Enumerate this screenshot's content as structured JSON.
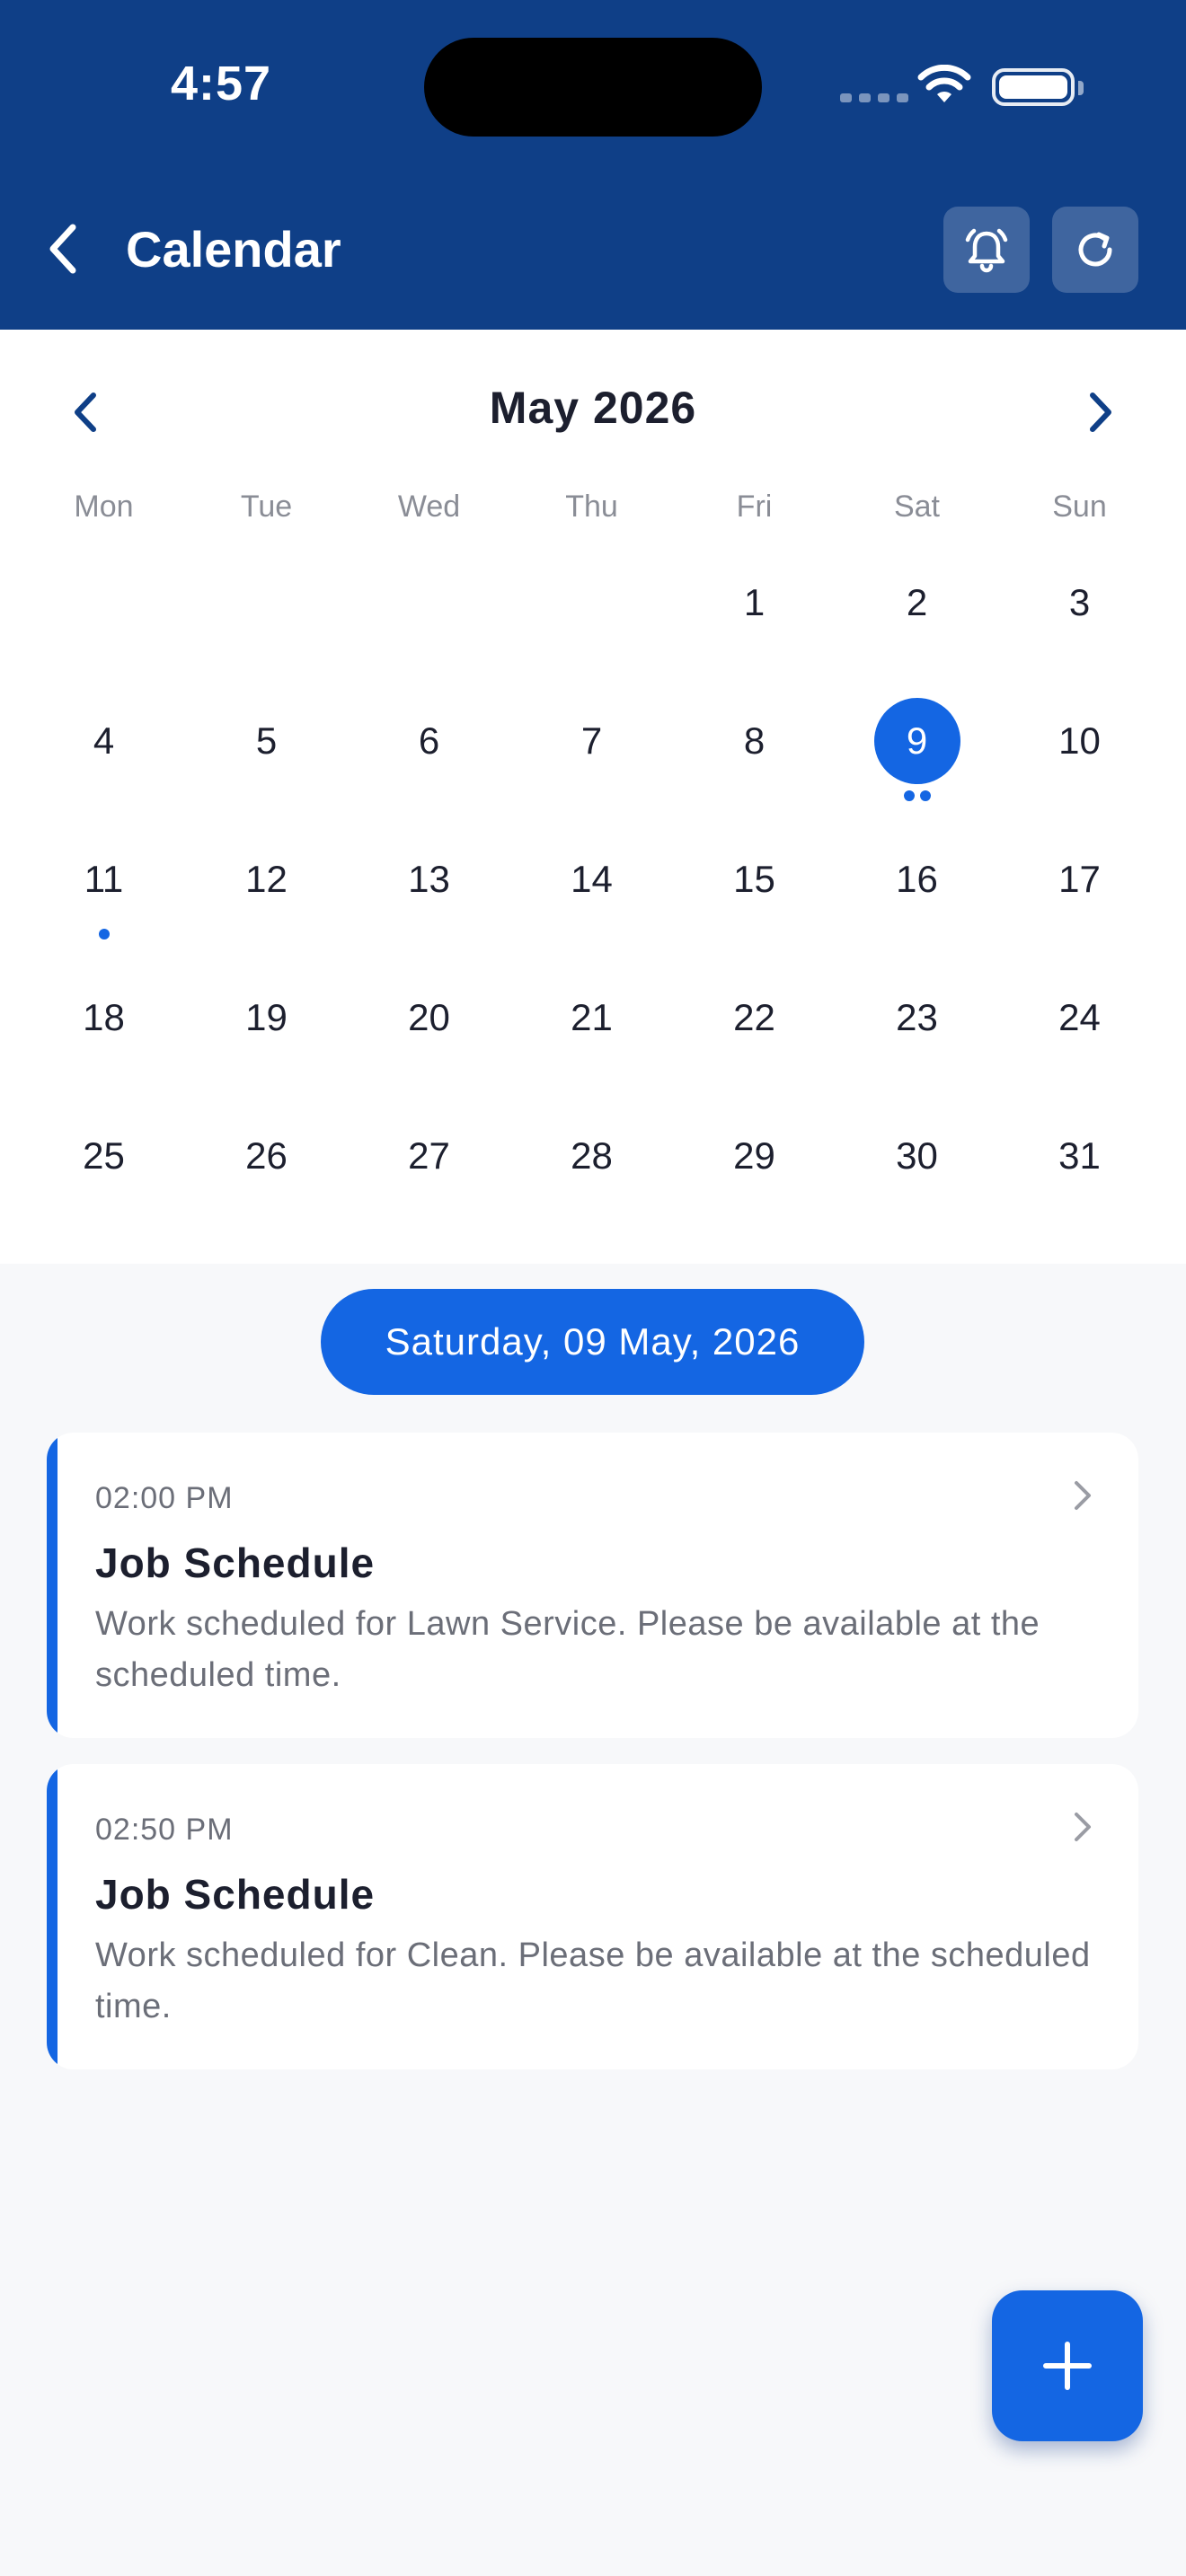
{
  "status_bar": {
    "time": "4:57"
  },
  "header": {
    "title": "Calendar",
    "back_icon": "chevron-left-icon",
    "actions": [
      {
        "name": "alarm-bell-icon"
      },
      {
        "name": "refresh-icon"
      }
    ],
    "background_color": "#0f3f87"
  },
  "calendar": {
    "month_label": "May 2026",
    "weekdays": [
      "Mon",
      "Tue",
      "Wed",
      "Thu",
      "Fri",
      "Sat",
      "Sun"
    ],
    "leading_empty_days": 4,
    "days": [
      "1",
      "2",
      "3",
      "4",
      "5",
      "6",
      "7",
      "8",
      "9",
      "10",
      "11",
      "12",
      "13",
      "14",
      "15",
      "16",
      "17",
      "18",
      "19",
      "20",
      "21",
      "22",
      "23",
      "24",
      "25",
      "26",
      "27",
      "28",
      "29",
      "30",
      "31"
    ],
    "selected_day": "9",
    "event_dots": {
      "9": 2,
      "11": 1
    },
    "accent_color": "#1466e3"
  },
  "selected_date_label": "Saturday, 09 May, 2026",
  "events": [
    {
      "time": "02:00 PM",
      "title": "Job Schedule",
      "description": "Work scheduled for Lawn Service. Please be available at the scheduled time."
    },
    {
      "time": "02:50 PM",
      "title": "Job Schedule",
      "description": "Work scheduled for Clean. Please be available at the scheduled time."
    }
  ],
  "fab": {
    "icon": "plus-icon"
  }
}
